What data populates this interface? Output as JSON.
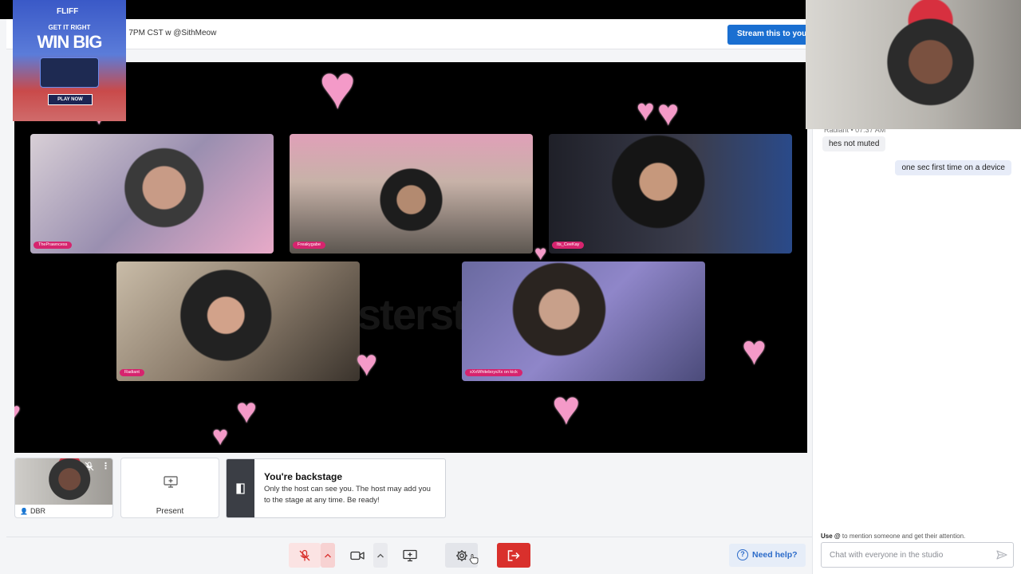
{
  "header": {
    "broadcast_title": "g 7PM CST w @SithMeow",
    "stream_button": "Stream this to you"
  },
  "ad": {
    "brand": "FLIFF",
    "line1": "GET IT RIGHT",
    "line2": "WIN BIG",
    "cta": "PLAY NOW"
  },
  "stage": {
    "watermark": "sterst",
    "participants": [
      {
        "name": "ThePrawncess"
      },
      {
        "name": "Freakygabe"
      },
      {
        "name": "Its_CeeKay"
      },
      {
        "name": "Radiant"
      },
      {
        "name": "xXxWhiteboysXx on kick"
      }
    ]
  },
  "backstage": {
    "self_name": "DBR",
    "present_label": "Present",
    "notice_title": "You're backstage",
    "notice_text": "Only the host can see you. The host may add you to the stage at any time. Be ready!"
  },
  "chat": {
    "meta": "Radiant • 07:37 AM",
    "messages": [
      {
        "text": "hes not muted",
        "direction": "in"
      },
      {
        "text": "one sec first time on a device",
        "direction": "out"
      }
    ],
    "hint_at": "Use @",
    "hint_rest": " to mention someone and get their attention.",
    "input_placeholder": "Chat with everyone in the studio"
  },
  "toolbar": {
    "help_label": "Need help?"
  },
  "colors": {
    "accent_blue": "#1a6fd1",
    "leave_red": "#d9302c",
    "name_tag_pink": "#d6246e",
    "heart_pink": "#f49ac8"
  }
}
